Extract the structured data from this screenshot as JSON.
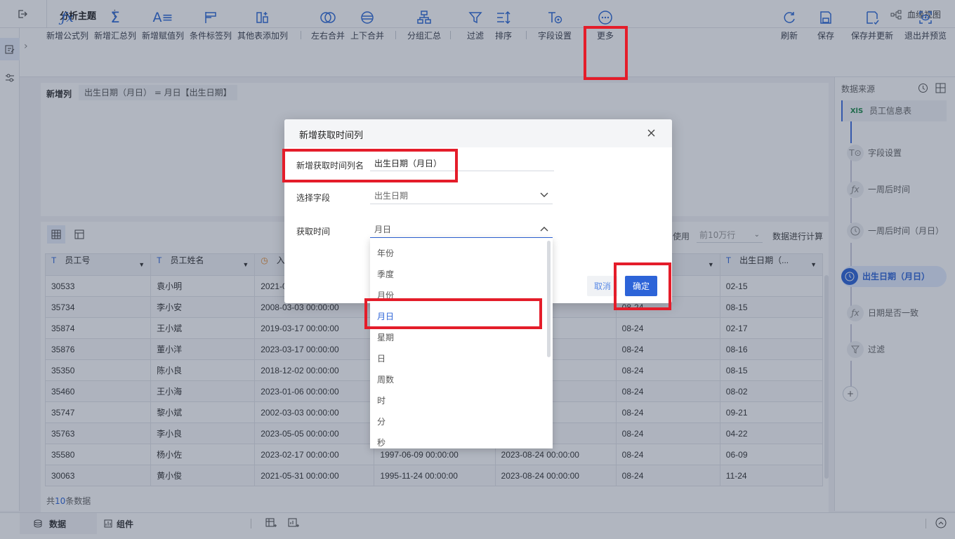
{
  "topbar": {
    "title": "分析主题",
    "lineage_view": "血缘视图"
  },
  "toolbar": {
    "items": [
      {
        "label": "新增公式列",
        "icon": "fx-icon"
      },
      {
        "label": "新增汇总列",
        "icon": "sigma-icon"
      },
      {
        "label": "新增赋值列",
        "icon": "assign-icon"
      },
      {
        "label": "条件标签列",
        "icon": "condition-tag-icon"
      },
      {
        "label": "其他表添加列",
        "icon": "add-column-icon"
      },
      {
        "label": "左右合并",
        "icon": "merge-lr-icon"
      },
      {
        "label": "上下合并",
        "icon": "merge-ud-icon"
      },
      {
        "label": "分组汇总",
        "icon": "group-icon"
      },
      {
        "label": "过滤",
        "icon": "filter-icon"
      },
      {
        "label": "排序",
        "icon": "sort-icon"
      },
      {
        "label": "字段设置",
        "icon": "field-settings-icon"
      },
      {
        "label": "更多",
        "icon": "more-icon"
      }
    ],
    "right_items": [
      {
        "label": "刷新",
        "icon": "refresh-icon"
      },
      {
        "label": "保存",
        "icon": "save-icon"
      },
      {
        "label": "保存并更新",
        "icon": "save-update-icon"
      },
      {
        "label": "退出并预览",
        "icon": "exit-preview-icon"
      }
    ]
  },
  "new_column": {
    "label": "新增列",
    "formula": "出生日期（月日） = 月日【出生日期】"
  },
  "right_panel": {
    "title": "数据来源",
    "steps": [
      {
        "label": "员工信息表",
        "icon": "xls-icon"
      },
      {
        "label": "字段设置",
        "icon": "field-settings-icon"
      },
      {
        "label": "一周后时间",
        "icon": "fx-icon"
      },
      {
        "label": "一周后时间（月日）",
        "icon": "clock-icon"
      },
      {
        "label": "出生日期（月日）",
        "icon": "clock-icon"
      },
      {
        "label": "日期是否一致",
        "icon": "fx-icon"
      },
      {
        "label": "过滤",
        "icon": "filter-icon"
      }
    ],
    "add_label": "+"
  },
  "table_options": {
    "use_label": "使用",
    "rows_option": "前10万行",
    "compute_label": "数据进行计算"
  },
  "table": {
    "headers": [
      "员工号",
      "员工姓名",
      "入",
      "",
      "",
      "间...",
      "出生日期（..."
    ],
    "rows": [
      [
        "30533",
        "袁小明",
        "2021-0",
        "",
        "",
        "",
        "02-15"
      ],
      [
        "35734",
        "李小安",
        "2008-03-03 00:00:00",
        "",
        "00:00:00",
        "08-24",
        "08-15"
      ],
      [
        "35874",
        "王小斌",
        "2019-03-17 00:00:00",
        "",
        "00:00:00",
        "08-24",
        "02-17"
      ],
      [
        "35876",
        "董小洋",
        "2023-03-17 00:00:00",
        "",
        "00:00:00",
        "08-24",
        "08-16"
      ],
      [
        "35350",
        "陈小良",
        "2018-12-02 00:00:00",
        "",
        "00:00:00",
        "08-24",
        "08-15"
      ],
      [
        "35460",
        "王小海",
        "2023-01-06 00:00:00",
        "",
        "00:00:00",
        "08-24",
        "08-02"
      ],
      [
        "35747",
        "黎小斌",
        "2002-03-03 00:00:00",
        "",
        "00:00:00",
        "08-24",
        "09-21"
      ],
      [
        "35763",
        "李小良",
        "2023-05-05 00:00:00",
        "",
        "00:00:00",
        "08-24",
        "04-22"
      ],
      [
        "35580",
        "杨小佐",
        "2023-02-17 00:00:00",
        "1997-06-09 00:00:00",
        "2023-08-24 00:00:00",
        "08-24",
        "06-09"
      ],
      [
        "30063",
        "黄小俊",
        "2021-05-31 00:00:00",
        "1995-11-24 00:00:00",
        "2023-08-24 00:00:00",
        "08-24",
        "11-24"
      ]
    ],
    "footer_prefix": "共",
    "footer_count": "10",
    "footer_suffix": "条数据"
  },
  "bottom": {
    "tab_data": "数据",
    "tab_component": "组件"
  },
  "dialog": {
    "title": "新增获取时间列",
    "name_label": "新增获取时间列名",
    "name_value": "出生日期（月日）",
    "field_label": "选择字段",
    "field_value": "出生日期",
    "time_label": "获取时间",
    "time_value": "月日",
    "options": [
      "年份",
      "季度",
      "月份",
      "月日",
      "星期",
      "日",
      "周数",
      "时",
      "分",
      "秒"
    ],
    "cancel": "取消",
    "ok": "确定"
  }
}
